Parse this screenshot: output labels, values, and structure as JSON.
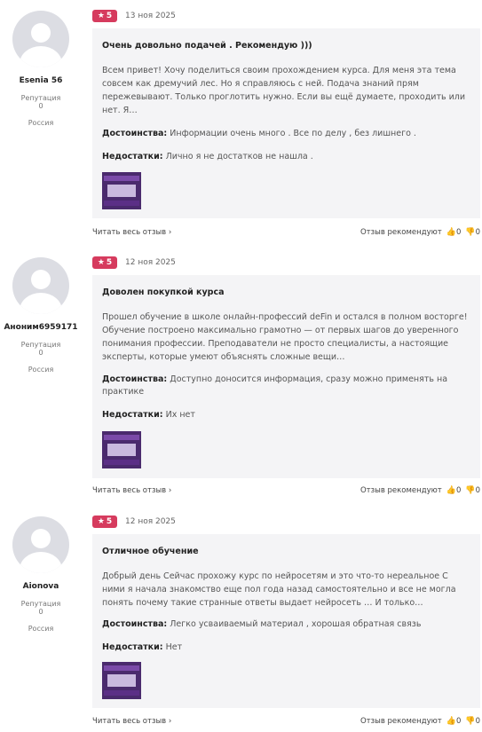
{
  "reviews": [
    {
      "user": {
        "name": "Esenia 56",
        "reputation_label": "Репутация",
        "reputation": "0",
        "country": "Россия"
      },
      "rating": "5",
      "date": "13 ноя 2025",
      "title": "Очень довольно подачей . Рекомендую )))",
      "text": "Всем привет! Хочу поделиться своим прохождением курса. Для меня эта тема совсем как дремучий лес. Но я справляюсь с ней. Подача знаний прям пережевывают. Только проглотить нужно. Если вы ещё думаете, проходить или нет. Я…",
      "pros_label": "Достоинства:",
      "pros": "Информации очень много . Все по делу , без лишнего .",
      "cons_label": "Недостатки:",
      "cons": "Лично я не достатков не нашла .",
      "read_all": "Читать весь отзыв",
      "recommend_label": "Отзыв рекомендуют",
      "likes": "0",
      "dislikes": "0"
    },
    {
      "user": {
        "name": "Аноним6959171",
        "reputation_label": "Репутация",
        "reputation": "0",
        "country": "Россия"
      },
      "rating": "5",
      "date": "12 ноя 2025",
      "title": "Доволен покупкой курса",
      "text": "Прошел обучение в школе онлайн-профессий deFin и остался в полном восторге! Обучение построено максимально грамотно — от первых шагов до уверенного понимания профессии. Преподаватели не просто специалисты, а настоящие эксперты, которые умеют объяснять сложные вещи…",
      "pros_label": "Достоинства:",
      "pros": "Доступно доносится информация, сразу можно применять на практике",
      "cons_label": "Недостатки:",
      "cons": "Их нет",
      "read_all": "Читать весь отзыв",
      "recommend_label": "Отзыв рекомендуют",
      "likes": "0",
      "dislikes": "0"
    },
    {
      "user": {
        "name": "Aionova",
        "reputation_label": "Репутация",
        "reputation": "0",
        "country": "Россия"
      },
      "rating": "5",
      "date": "12 ноя 2025",
      "title": "Отличное обучение",
      "text": "Добрый день Сейчас прохожу курс по нейросетям и это что-то нереальное С ними я начала знакомство еще пол года назад самостоятельно и все не могла понять почему такие странные ответы выдает нейросеть … И только…",
      "pros_label": "Достоинства:",
      "pros": "Легко усваиваемый материал , хорошая обратная связь",
      "cons_label": "Недостатки:",
      "cons": "Нет",
      "read_all": "Читать весь отзыв",
      "recommend_label": "Отзыв рекомендуют",
      "likes": "0",
      "dislikes": "0"
    }
  ],
  "icons": {
    "star": "★",
    "chevron": "›",
    "thumb_up": "👍",
    "thumb_down": "👎"
  },
  "colors": {
    "rating_badge": "#d63b5e",
    "card_bg": "#f4f4f6"
  }
}
